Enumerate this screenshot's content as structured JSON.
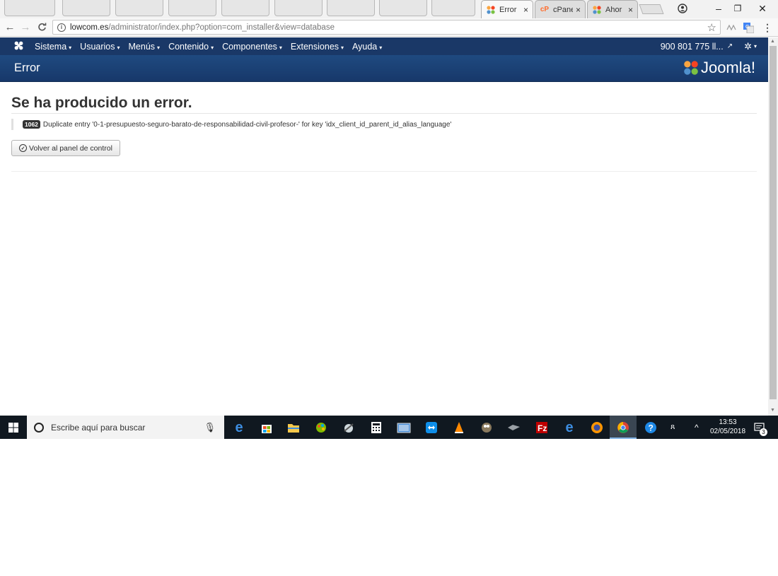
{
  "browser": {
    "tabs": [
      {
        "label": "Error",
        "close": "×",
        "icon": "joomla-icon"
      },
      {
        "label": "cPane",
        "close": "×",
        "icon": "cpanel-icon"
      },
      {
        "label": "Ahor",
        "close": "×",
        "icon": "joomla-icon"
      }
    ],
    "url_host": "lowcom.es",
    "url_path": "/administrator/index.php?option=com_installer&view=database",
    "info_glyph": "i",
    "window_controls": {
      "minimize": "–",
      "restore": "❐",
      "close": "✕"
    }
  },
  "joomla": {
    "nav": {
      "menu": [
        "Sistema",
        "Usuarios",
        "Menús",
        "Contenido",
        "Componentes",
        "Extensiones",
        "Ayuda"
      ],
      "site_label": "900 801 775 ll...",
      "caret": "▾"
    },
    "page_title": "Error",
    "brand": "Joomla!",
    "brand_color": "#1a3867"
  },
  "error": {
    "heading": "Se ha producido un error.",
    "code": "1062",
    "message": "Duplicate entry '0-1-presupuesto-seguro-barato-de-responsabilidad-civil-profesor-' for key 'idx_client_id_parent_id_alias_language'",
    "back_button": "Volver al panel de control"
  },
  "taskbar": {
    "search_placeholder": "Escribe aquí para buscar",
    "time": "13:53",
    "date": "02/05/2018",
    "notification_count": "3"
  }
}
